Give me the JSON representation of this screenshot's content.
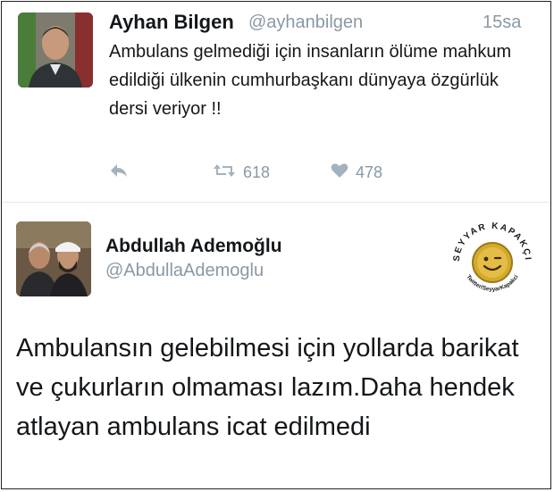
{
  "tweet1": {
    "author_name": "Ayhan Bilgen",
    "handle": "@ayhanbilgen",
    "timestamp": "15sa",
    "text": "Ambulans gelmediği için insanların ölüme mahkum edildiği ülkenin cumhurbaşkanı dünyaya özgürlük dersi veriyor !!",
    "retweets": "618",
    "likes": "478"
  },
  "tweet2": {
    "author_name": "Abdullah Ademoğlu",
    "handle": "@AbdullaAdemoglu",
    "text": "Ambulansın gelebilmesi için yollarda barikat ve çukurların olmaması lazım.Daha hendek atlayan ambulans icat edilmedi"
  },
  "watermark": {
    "top_text": "SEYYAR KAPAKÇI",
    "bottom_text": "Twitter/SeyyarKapakci"
  },
  "colors": {
    "text": "#14171a",
    "muted": "#8899a6",
    "divider": "#e1e8ed",
    "stamp_gold": "#d4aa2e"
  },
  "icons": [
    "reply-icon",
    "retweet-icon",
    "like-icon"
  ]
}
